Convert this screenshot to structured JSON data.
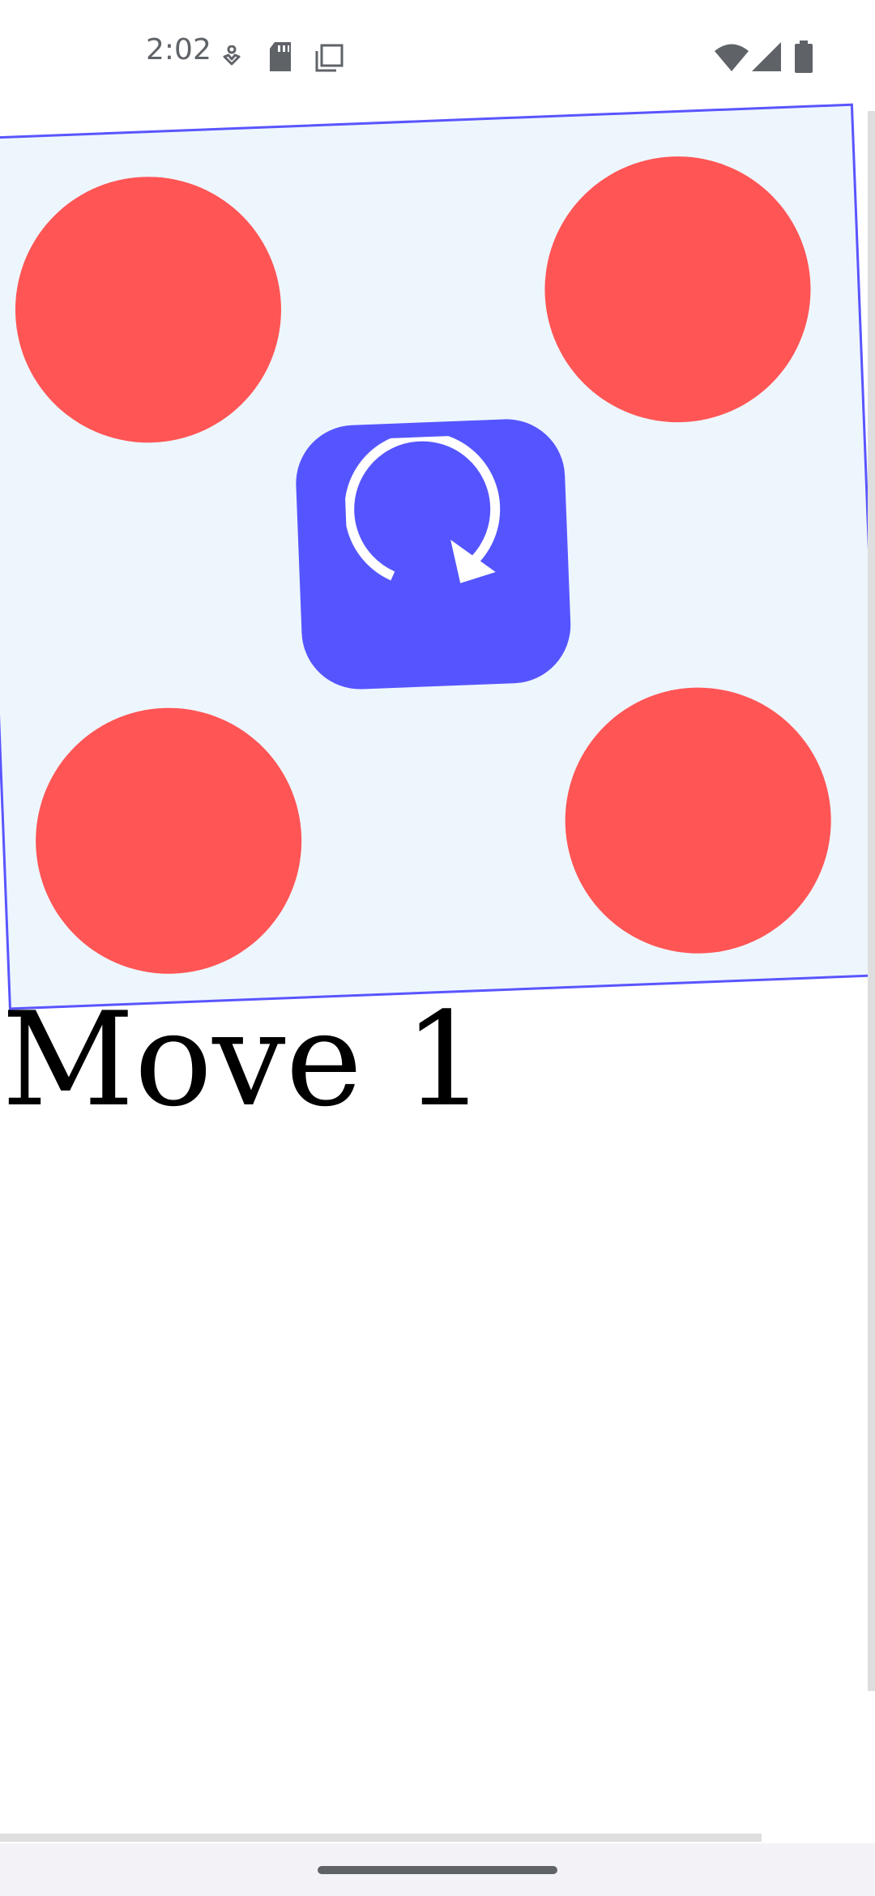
{
  "status_bar": {
    "time": "2:02",
    "left_icons": [
      "accessibility-icon",
      "sd-card-icon",
      "screenshot-icon"
    ],
    "right_icons": [
      "wifi-icon",
      "cell-signal-icon",
      "battery-icon"
    ]
  },
  "game": {
    "tokens": [
      "red-token",
      "red-token",
      "red-token",
      "red-token"
    ],
    "rotate_button_icon": "rotate-clockwise-icon",
    "board_rotation_deg": -2.2,
    "colors": {
      "board_fill": "#eef6fd",
      "board_border": "#5a55ff",
      "token": "#ff5555",
      "rotate_button": "#5555ff"
    }
  },
  "move_counter": {
    "text": "Move 1"
  }
}
